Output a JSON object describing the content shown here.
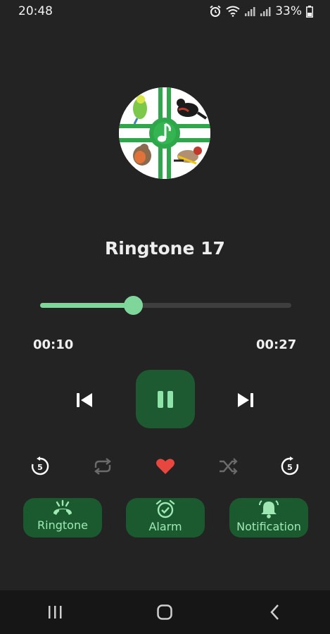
{
  "status_bar": {
    "time": "20:48",
    "battery": "33%",
    "icons": [
      "alarm-icon",
      "wifi-icon",
      "signal-icon",
      "signal-icon",
      "battery-icon"
    ]
  },
  "player": {
    "title": "Ringtone 17",
    "elapsed": "00:10",
    "duration": "00:27",
    "progress_fraction": 0.37,
    "is_playing": true
  },
  "controls": {
    "icons": [
      "previous-icon",
      "pause-icon",
      "next-icon",
      "rewind-5-icon",
      "repeat-icon",
      "heart-icon",
      "shuffle-icon",
      "forward-5-icon"
    ]
  },
  "actions": [
    {
      "label": "Ringtone",
      "icon": "phone-ringing-icon"
    },
    {
      "label": "Alarm",
      "icon": "alarm-clock-icon"
    },
    {
      "label": "Notification",
      "icon": "bell-icon"
    }
  ],
  "colors": {
    "accent": "#7fd69a",
    "button_bg": "#1b5a2f",
    "background": "#232323",
    "heart": "#e8473f"
  },
  "navigation": {
    "icons": [
      "recent-apps-icon",
      "home-icon",
      "back-icon"
    ]
  }
}
